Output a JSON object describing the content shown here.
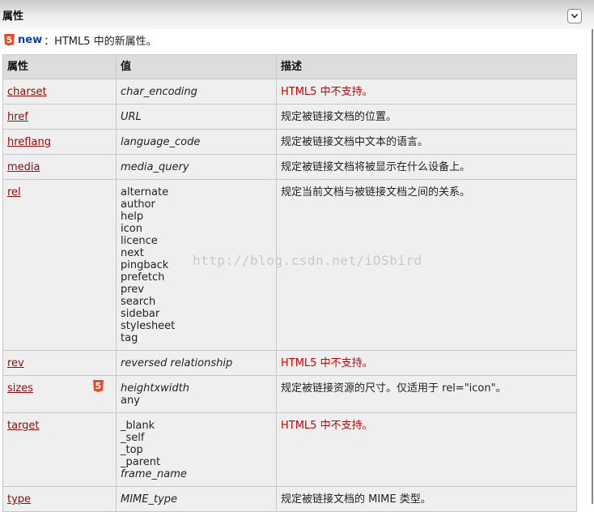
{
  "section": {
    "title": "属性"
  },
  "notice": {
    "badge": "5",
    "keyword": "new",
    "text": "：HTML5 中的新属性。"
  },
  "table": {
    "headers": [
      "属性",
      "值",
      "描述"
    ],
    "rows": [
      {
        "name": "charset",
        "values": [
          "char_encoding"
        ],
        "values_italic": true,
        "desc": "HTML5 中不支持。",
        "unsupported": true
      },
      {
        "name": "href",
        "values": [
          "URL"
        ],
        "values_italic": true,
        "desc": "规定被链接文档的位置。"
      },
      {
        "name": "hreflang",
        "values": [
          "language_code"
        ],
        "values_italic": true,
        "desc": "规定被链接文档中文本的语言。"
      },
      {
        "name": "media",
        "values": [
          "media_query"
        ],
        "values_italic": true,
        "desc": "规定被链接文档将被显示在什么设备上。"
      },
      {
        "name": "rel",
        "values": [
          "alternate",
          "author",
          "help",
          "icon",
          "licence",
          "next",
          "pingback",
          "prefetch",
          "prev",
          "search",
          "sidebar",
          "stylesheet",
          "tag"
        ],
        "desc": "规定当前文档与被链接文档之间的关系。"
      },
      {
        "name": "rev",
        "values": [
          "reversed relationship"
        ],
        "values_italic": true,
        "desc": "HTML5 中不支持。",
        "unsupported": true
      },
      {
        "name": "sizes",
        "values": [
          "heightxwidth",
          "any"
        ],
        "italic_first": true,
        "html5_badge": "5",
        "desc": "规定被链接资源的尺寸。仅适用于 rel=\"icon\"。"
      },
      {
        "name": "target",
        "values": [
          "_blank",
          "_self",
          "_top",
          "_parent",
          "frame_name"
        ],
        "italic_last": true,
        "desc": "HTML5 中不支持。",
        "unsupported": true
      },
      {
        "name": "type",
        "values": [
          "MIME_type"
        ],
        "values_italic": true,
        "desc": "规定被链接文档的 MIME 类型。"
      }
    ]
  },
  "watermark": "http://blog.csdn.net/iOSbird"
}
